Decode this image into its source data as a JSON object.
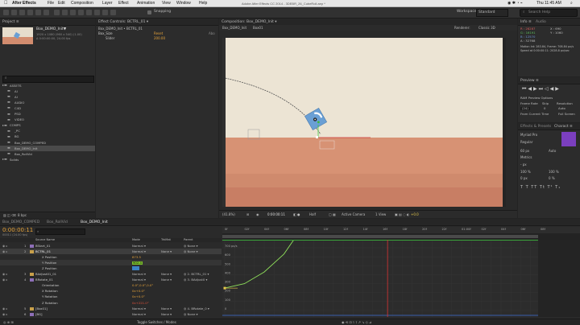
{
  "menubar": {
    "app": "After Effects",
    "items": [
      "File",
      "Edit",
      "Composition",
      "Layer",
      "Effect",
      "Animation",
      "View",
      "Window",
      "Help"
    ],
    "doc_title": "Adobe After Effects CC 2014 - 3DEBR_26_CubeRoll.aep *",
    "clock": "Thu 11:45 AM"
  },
  "toolbar": {
    "snapping": "Snapping",
    "workspace_label": "Workspace:",
    "workspace_value": "Standard",
    "search_placeholder": "Search Help"
  },
  "project": {
    "tab": "Project ≡",
    "item_name": "Box_DEMO_Init▼",
    "item_info1": "1920 x 1080 (960 x 540) (1.00)",
    "item_info2": "Δ 0:00:00:00, 24.00 fps",
    "search_icon": "search-icon",
    "tree": [
      {
        "label": "ASSETS",
        "indent": 0
      },
      {
        "label": "AI",
        "indent": 1
      },
      {
        "label": "AI",
        "indent": 1
      },
      {
        "label": "AUDIO",
        "indent": 1
      },
      {
        "label": "C4D",
        "indent": 1
      },
      {
        "label": "PSD",
        "indent": 1
      },
      {
        "label": "VIDEO",
        "indent": 1
      },
      {
        "label": "COMPS",
        "indent": 0
      },
      {
        "label": "_PC",
        "indent": 1
      },
      {
        "label": "BG",
        "indent": 1
      },
      {
        "label": "Box_DEMO_COMPED",
        "indent": 1
      },
      {
        "label": "Box_DEMO_Init",
        "indent": 1
      },
      {
        "label": "Box_RollVid",
        "indent": 1
      },
      {
        "label": "Solids",
        "indent": 0
      }
    ],
    "footer": "8 bpc"
  },
  "effect_controls": {
    "tab": "Effect Controls: BCTRL_01 ▾",
    "layer_path": "Box_DEMO_Init • BCTRL_01",
    "effect_name": "Box_Size",
    "reset": "Reset",
    "about": "Abo",
    "param_label": "Slider",
    "param_value": "200.00"
  },
  "composition": {
    "tab": "Composition: Box_DEMO_Init ▾",
    "breadcrumb": "Box_DEMO_Init",
    "breadcrumb2": "Box01",
    "camera_label": "Active Camera",
    "renderer_label": "Renderer:",
    "renderer_value": "Classic 3D",
    "footer": {
      "zoom": "(41.8%)",
      "timecode": "0:00:00:11",
      "resolution": "Half",
      "view": "Active Camera",
      "views": "1 View",
      "exposure": "+0.0"
    },
    "colors": {
      "sky": "#ece4d4",
      "ground_top": "#d79274",
      "ground_bottom": "#c87e64",
      "cube": "#6a9fd4"
    }
  },
  "info": {
    "tab": "Info ≡",
    "tab2": "Audio",
    "r": "R : 28287",
    "g": "G : 16191",
    "b": "B : 12570",
    "a": "A : 32768",
    "x": "X : 690",
    "y": "Y : 1060",
    "motion": "Motion Int: 283.84, Frame: 708.84 px/s",
    "speed": "Speed at 0:00:00:11: 2028.8 px/sec"
  },
  "preview": {
    "tab": "Preview ≡",
    "ram": "RAM Preview Options",
    "frame_rate_label": "Frame Rate",
    "skip_label": "Skip",
    "resolution_label": "Resolution",
    "frame_rate": "(24)",
    "skip": "0",
    "resolution": "Auto",
    "from_current": "From Current Time",
    "full_screen": "Full Screen"
  },
  "effects_presets": {
    "tab": "Effects & Presets",
    "tab2": "Charact ≡",
    "font": "Myriad Pro",
    "style": "Regular",
    "size": "60 px",
    "auto": "Auto",
    "metrics": "Metrics",
    "size2": "- px",
    "pct1": "100 %",
    "pct2": "100 %",
    "px": "0 px",
    "pct3": "0 %"
  },
  "timeline": {
    "tabs": [
      "Box_DEMO_COMPED",
      "Box_RollVid",
      "Box_DEMO_Init"
    ],
    "timecode": "0:00:00:11",
    "frame_info": "00011 (24.00 fps)",
    "search_icon": "search-icon",
    "columns": {
      "source": "Source Name",
      "mode": "Mode",
      "trkmat": "TrkMat",
      "parent": "Parent"
    },
    "layers": [
      {
        "num": "1",
        "name": "BStart_01",
        "mode": "Normal",
        "trk": "",
        "parent": "None"
      },
      {
        "num": "2",
        "name": "BCTRL_01",
        "mode": "Normal",
        "trk": "None",
        "parent": "None",
        "selected": true
      },
      {
        "num": "",
        "name": "X Position",
        "value": "873.5",
        "type": "prop"
      },
      {
        "num": "",
        "name": "Y Position",
        "value": "902.4",
        "type": "prop-hl"
      },
      {
        "num": "",
        "name": "Z Position",
        "value": "",
        "type": "prop-hl2"
      },
      {
        "num": "3",
        "name": "BAdjust01_01",
        "mode": "Normal",
        "trk": "None",
        "parent": "2. BCTRL_01"
      },
      {
        "num": "4",
        "name": "BRotate_01",
        "mode": "Normal",
        "trk": "None",
        "parent": "3. BAdjust0"
      },
      {
        "num": "",
        "name": "Orientation",
        "value": "0.0°,0.0°,0.0°",
        "type": "prop"
      },
      {
        "num": "",
        "name": "X Rotation",
        "value": "0x+0.0°",
        "type": "prop"
      },
      {
        "num": "",
        "name": "Y Rotation",
        "value": "0x+0.0°",
        "type": "prop"
      },
      {
        "num": "",
        "name": "Z Rotation",
        "value": "0x+221.0°",
        "type": "prop-red"
      },
      {
        "num": "5",
        "name": "[Box01]",
        "mode": "Normal",
        "trk": "None",
        "parent": "4. BRotate_0"
      },
      {
        "num": "6",
        "name": "[BG]",
        "mode": "Normal",
        "trk": "None",
        "parent": "None"
      }
    ],
    "ruler": [
      "0f",
      "02f",
      "04f",
      "06f",
      "08f",
      "10f",
      "12f",
      "14f",
      "16f",
      "18f",
      "20f",
      "22f",
      "01:00f",
      "02f",
      "04f",
      "06f",
      "08f"
    ],
    "graph_labels": [
      "700 px/s",
      "600",
      "500",
      "400",
      "300",
      "200",
      "100",
      "0"
    ],
    "footer": "Toggle Switches / Modes",
    "curve": {
      "keyframe_start_frame": 0,
      "keyframe_end_frame": 4,
      "playhead_frame": 11,
      "values": [
        250,
        300,
        430,
        630,
        950
      ]
    }
  }
}
